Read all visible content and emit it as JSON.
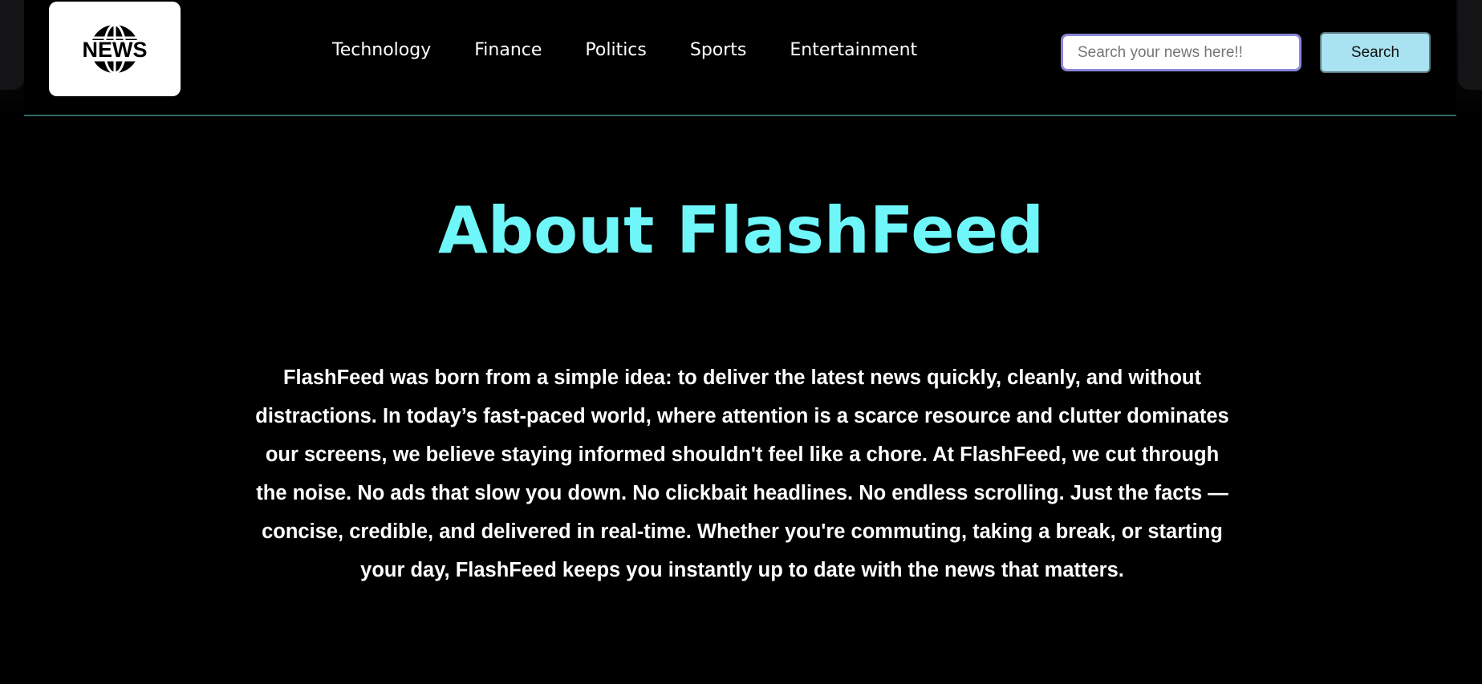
{
  "header": {
    "logo_text": "NEWS",
    "nav": [
      {
        "label": "Technology"
      },
      {
        "label": "Finance"
      },
      {
        "label": "Politics"
      },
      {
        "label": "Sports"
      },
      {
        "label": "Entertainment"
      }
    ],
    "search": {
      "placeholder": "Search your news here!!",
      "value": "",
      "button_label": "Search"
    }
  },
  "main": {
    "title": "About FlashFeed",
    "body": "FlashFeed was born from a simple idea: to deliver the latest news quickly, cleanly, and without distractions. In today’s fast-paced world, where attention is a scarce resource and clutter dominates our screens, we believe staying informed shouldn't feel like a chore. At FlashFeed, we cut through the noise. No ads that slow you down. No clickbait headlines. No endless scrolling. Just the facts — concise, credible, and delivered in real-time. Whether you're commuting, taking a break, or starting your day, FlashFeed keeps you instantly up to date with the news that matters."
  },
  "colors": {
    "background": "#000000",
    "title_accent": "#6ff6f9",
    "search_button_bg": "#a9e2f0",
    "search_border": "#8a86d8",
    "header_divider": "#2d6b66"
  }
}
